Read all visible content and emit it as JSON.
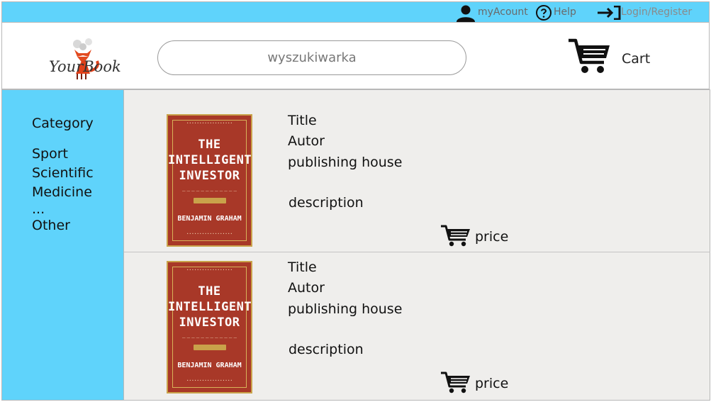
{
  "topbar": {
    "account_label": "myAcount",
    "help_label": "Help",
    "login_label": "Login/Register",
    "color": "#5fd3fb"
  },
  "header": {
    "logo_text": "YourBook",
    "search_placeholder": "wyszukiwarka",
    "cart_label": "Cart"
  },
  "sidebar": {
    "heading": "Category",
    "items": [
      {
        "label": "Sport"
      },
      {
        "label": "Scientific"
      },
      {
        "label": "Medicine"
      },
      {
        "label": "..."
      },
      {
        "label": "Other"
      }
    ]
  },
  "books": [
    {
      "title_label": "Title",
      "author_label": "Autor",
      "publisher_label": "publishing house",
      "description_label": "description",
      "price_label": "price",
      "cover": {
        "title_line_1": "THE",
        "title_line_2": "INTELLIGENT",
        "title_line_3": "INVESTOR",
        "author": "BENJAMIN GRAHAM",
        "color": "#a83828"
      }
    },
    {
      "title_label": "Title",
      "author_label": "Autor",
      "publisher_label": "publishing house",
      "description_label": "description",
      "price_label": "price",
      "cover": {
        "title_line_1": "THE",
        "title_line_2": "INTELLIGENT",
        "title_line_3": "INVESTOR",
        "author": "BENJAMIN GRAHAM",
        "color": "#a83828"
      }
    }
  ]
}
